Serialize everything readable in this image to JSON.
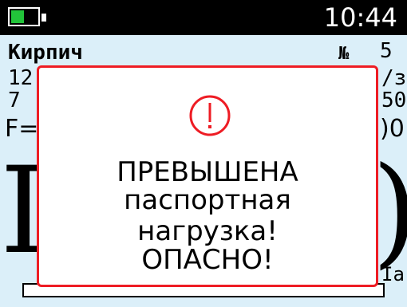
{
  "status": {
    "time": "10:44",
    "battery_icon": "battery-icon",
    "battery_level": 0.5,
    "battery_color": "#22c43a"
  },
  "measurement": {
    "material": "Кирпич",
    "number_label": "№",
    "number_value": "5",
    "row2_left": "12",
    "row2_right": "/з",
    "row3_left": "7",
    "row3_right": "50",
    "force_left": "F=",
    "force_right": ")0",
    "big_left": "I",
    "big_right": ")",
    "unit_right": "Ia"
  },
  "dialog": {
    "icon": "exclamation-circle-icon",
    "border_color": "#ee1c24",
    "line1": "ПРЕВЫШЕНА",
    "line2": "паспортная",
    "line3": "нагрузка!",
    "line4": "ОПАСНО!"
  }
}
